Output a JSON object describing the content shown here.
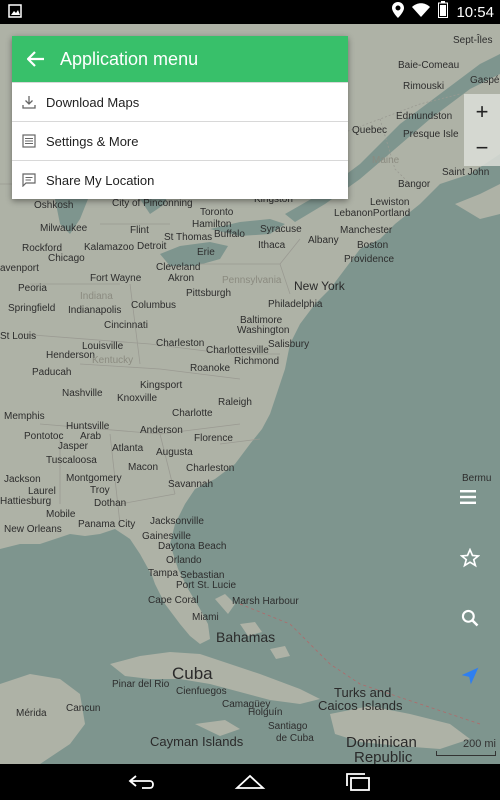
{
  "status": {
    "time": "10:54"
  },
  "menu": {
    "title": "Application menu",
    "items": [
      "Download Maps",
      "Settings & More",
      "Share My Location"
    ]
  },
  "map": {
    "zoom_in": "+",
    "zoom_out": "−",
    "scale": "200 mi",
    "labels": [
      {
        "name": "label-sept-iles",
        "text": "Sept-Îles",
        "size": "small"
      },
      {
        "name": "label-baie-comeau",
        "text": "Baie-Comeau",
        "size": "small"
      },
      {
        "name": "label-gaspe",
        "text": "Gaspé",
        "size": "small"
      },
      {
        "name": "label-rimouski",
        "text": "Rimouski",
        "size": "small"
      },
      {
        "name": "label-edmundston",
        "text": "Edmundston",
        "size": "small"
      },
      {
        "name": "label-quebec",
        "text": "Quebec",
        "size": "small"
      },
      {
        "name": "label-presque-isle",
        "text": "Presque Isle",
        "size": "small"
      },
      {
        "name": "label-maine",
        "text": "Maine",
        "size": "faint"
      },
      {
        "name": "label-bangor",
        "text": "Bangor",
        "size": "small"
      },
      {
        "name": "label-saint-john",
        "text": "Saint John",
        "size": "small"
      },
      {
        "name": "label-oshkosh",
        "text": "Oshkosh",
        "size": "small"
      },
      {
        "name": "label-city-of-pinconning",
        "text": "City of Pinconning",
        "size": "small"
      },
      {
        "name": "label-toronto",
        "text": "Toronto",
        "size": "small"
      },
      {
        "name": "label-kingston",
        "text": "Kingston",
        "size": "small"
      },
      {
        "name": "label-lewiston",
        "text": "Lewiston",
        "size": "small"
      },
      {
        "name": "label-milwaukee",
        "text": "Milwaukee",
        "size": "small"
      },
      {
        "name": "label-flint",
        "text": "Flint",
        "size": "small"
      },
      {
        "name": "label-hamilton",
        "text": "Hamilton",
        "size": "small"
      },
      {
        "name": "label-st-thomas",
        "text": "St Thomas",
        "size": "small"
      },
      {
        "name": "label-buffalo",
        "text": "Buffalo",
        "size": "small"
      },
      {
        "name": "label-syracuse",
        "text": "Syracuse",
        "size": "small"
      },
      {
        "name": "label-albany",
        "text": "Albany",
        "size": "small"
      },
      {
        "name": "label-lebanon",
        "text": "LebanonPortland",
        "size": "small"
      },
      {
        "name": "label-manchester",
        "text": "Manchester",
        "size": "small"
      },
      {
        "name": "label-rockford",
        "text": "Rockford",
        "size": "small"
      },
      {
        "name": "label-kalamazoo",
        "text": "Kalamazoo",
        "size": "small"
      },
      {
        "name": "label-detroit",
        "text": "Detroit",
        "size": "small"
      },
      {
        "name": "label-erie",
        "text": "Erie",
        "size": "small"
      },
      {
        "name": "label-ithaca",
        "text": "Ithaca",
        "size": "small"
      },
      {
        "name": "label-boston",
        "text": "Boston",
        "size": "small"
      },
      {
        "name": "label-chicago",
        "text": "Chicago",
        "size": "small"
      },
      {
        "name": "label-providence",
        "text": "Providence",
        "size": "small"
      },
      {
        "name": "label-davenport",
        "text": "avenport",
        "size": "small"
      },
      {
        "name": "label-cleveland",
        "text": "Cleveland",
        "size": "small"
      },
      {
        "name": "label-fort-wayne",
        "text": "Fort Wayne",
        "size": "small"
      },
      {
        "name": "label-akron",
        "text": "Akron",
        "size": "small"
      },
      {
        "name": "label-pennsylvania",
        "text": "Pennsylvania",
        "size": "faint"
      },
      {
        "name": "label-peoria",
        "text": "Peoria",
        "size": "small"
      },
      {
        "name": "label-indiana",
        "text": "Indiana",
        "size": "faint"
      },
      {
        "name": "label-new-york",
        "text": "New York",
        "size": "small"
      },
      {
        "name": "label-pittsburgh",
        "text": "Pittsburgh",
        "size": "small"
      },
      {
        "name": "label-springfield",
        "text": "Springfield",
        "size": "small"
      },
      {
        "name": "label-indianapolis",
        "text": "Indianapolis",
        "size": "small"
      },
      {
        "name": "label-columbus",
        "text": "Columbus",
        "size": "small"
      },
      {
        "name": "label-philadelphia",
        "text": "Philadelphia",
        "size": "small"
      },
      {
        "name": "label-cincinnati",
        "text": "Cincinnati",
        "size": "small"
      },
      {
        "name": "label-baltimore",
        "text": "Baltimore",
        "size": "small"
      },
      {
        "name": "label-washington",
        "text": "Washington",
        "size": "small"
      },
      {
        "name": "label-st-louis",
        "text": "St Louis",
        "size": "small"
      },
      {
        "name": "label-charleston-wv",
        "text": "Charleston",
        "size": "small"
      },
      {
        "name": "label-louisville",
        "text": "Louisville",
        "size": "small"
      },
      {
        "name": "label-charlottesville",
        "text": "Charlottesville",
        "size": "small"
      },
      {
        "name": "label-salisbury",
        "text": "Salisbury",
        "size": "small"
      },
      {
        "name": "label-henderson",
        "text": "Henderson",
        "size": "small"
      },
      {
        "name": "label-kentucky",
        "text": "Kentucky",
        "size": "faint"
      },
      {
        "name": "label-richmond",
        "text": "Richmond",
        "size": "small"
      },
      {
        "name": "label-paducah",
        "text": "Paducah",
        "size": "small"
      },
      {
        "name": "label-roanoke",
        "text": "Roanoke",
        "size": "small"
      },
      {
        "name": "label-kingsport",
        "text": "Kingsport",
        "size": "small"
      },
      {
        "name": "label-nashville",
        "text": "Nashville",
        "size": "small"
      },
      {
        "name": "label-knoxville",
        "text": "Knoxville",
        "size": "small"
      },
      {
        "name": "label-raleigh",
        "text": "Raleigh",
        "size": "small"
      },
      {
        "name": "label-memphis",
        "text": "Memphis",
        "size": "small"
      },
      {
        "name": "label-charlotte",
        "text": "Charlotte",
        "size": "small"
      },
      {
        "name": "label-huntsville",
        "text": "Huntsville",
        "size": "small"
      },
      {
        "name": "label-pontotoc",
        "text": "Pontotoc",
        "size": "small"
      },
      {
        "name": "label-arab",
        "text": "Arab",
        "size": "small"
      },
      {
        "name": "label-anderson",
        "text": "Anderson",
        "size": "small"
      },
      {
        "name": "label-florence",
        "text": "Florence",
        "size": "small"
      },
      {
        "name": "label-jasper",
        "text": "Jasper",
        "size": "small"
      },
      {
        "name": "label-atlanta",
        "text": "Atlanta",
        "size": "small"
      },
      {
        "name": "label-augusta",
        "text": "Augusta",
        "size": "small"
      },
      {
        "name": "label-tuscaloosa",
        "text": "Tuscaloosa",
        "size": "small"
      },
      {
        "name": "label-macon",
        "text": "Macon",
        "size": "small"
      },
      {
        "name": "label-charleston-sc",
        "text": "Charleston",
        "size": "small"
      },
      {
        "name": "label-jackson",
        "text": "Jackson",
        "size": "small"
      },
      {
        "name": "label-montgomery",
        "text": "Montgomery",
        "size": "small"
      },
      {
        "name": "label-savannah",
        "text": "Savannah",
        "size": "small"
      },
      {
        "name": "label-laurel",
        "text": "Laurel",
        "size": "small"
      },
      {
        "name": "label-troy",
        "text": "Troy",
        "size": "small"
      },
      {
        "name": "label-hattiesburg",
        "text": "Hattiesburg",
        "size": "small"
      },
      {
        "name": "label-dothan",
        "text": "Dothan",
        "size": "small"
      },
      {
        "name": "label-bermuda",
        "text": "Bermu",
        "size": "small"
      },
      {
        "name": "label-mobile",
        "text": "Mobile",
        "size": "small"
      },
      {
        "name": "label-jacksonville",
        "text": "Jacksonville",
        "size": "small"
      },
      {
        "name": "label-new-orleans",
        "text": "New Orleans",
        "size": "small"
      },
      {
        "name": "label-panama-city",
        "text": "Panama City",
        "size": "small"
      },
      {
        "name": "label-gainesville",
        "text": "Gainesville",
        "size": "small"
      },
      {
        "name": "label-daytona-beach",
        "text": "Daytona Beach",
        "size": "small"
      },
      {
        "name": "label-orlando",
        "text": "Orlando",
        "size": "small"
      },
      {
        "name": "label-tampa",
        "text": "Tampa",
        "size": "small"
      },
      {
        "name": "label-sebastian",
        "text": "Sebastian",
        "size": "small"
      },
      {
        "name": "label-port-st-lucie",
        "text": "Port St. Lucie",
        "size": "small"
      },
      {
        "name": "label-cape-coral",
        "text": "Cape Coral",
        "size": "small"
      },
      {
        "name": "label-marsh-harbour",
        "text": "Marsh Harbour",
        "size": "small"
      },
      {
        "name": "label-miami",
        "text": "Miami",
        "size": "small"
      },
      {
        "name": "label-bahamas",
        "text": "Bahamas",
        "size": "big"
      },
      {
        "name": "label-cuba",
        "text": "Cuba",
        "size": "big"
      },
      {
        "name": "label-pinar-del-rio",
        "text": "Pinar del Rio",
        "size": "small"
      },
      {
        "name": "label-cienfuegos",
        "text": "Cienfuegos",
        "size": "small"
      },
      {
        "name": "label-turks-caicos",
        "text": "Turks and",
        "size": "big"
      },
      {
        "name": "label-caicos-islands",
        "text": "Caicos Islands",
        "size": "big"
      },
      {
        "name": "label-merida",
        "text": "Mérida",
        "size": "small"
      },
      {
        "name": "label-cancun",
        "text": "Cancun",
        "size": "small"
      },
      {
        "name": "label-camaguey",
        "text": "Camagüey",
        "size": "small"
      },
      {
        "name": "label-holguin",
        "text": "Holguín",
        "size": "small"
      },
      {
        "name": "label-santiago",
        "text": "Santiago",
        "size": "small"
      },
      {
        "name": "label-de-cuba",
        "text": "de Cuba",
        "size": "small"
      },
      {
        "name": "label-cayman-islands",
        "text": "Cayman Islands",
        "size": "big"
      },
      {
        "name": "label-dominican",
        "text": "Dominican",
        "size": "big"
      },
      {
        "name": "label-republic",
        "text": "Republic",
        "size": "big"
      }
    ]
  }
}
